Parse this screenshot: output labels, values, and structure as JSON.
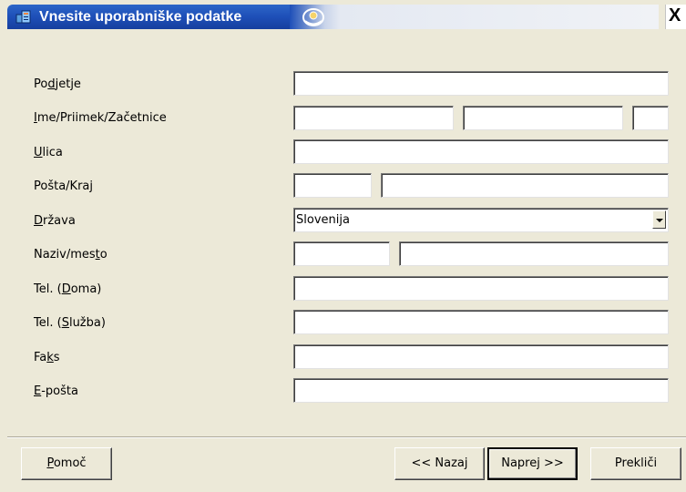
{
  "window": {
    "title": "Vnesite uporabniške podatke",
    "close_glyph": "X"
  },
  "form": {
    "company_label": "Podjetje",
    "company_value": "",
    "name_label": "Ime/Priimek/Začetnice",
    "first_name_value": "",
    "last_name_value": "",
    "initials_value": "",
    "street_label": "Ulica",
    "street_value": "",
    "post_label": "Pošta/Kraj",
    "postcode_value": "",
    "city_value": "",
    "country_label": "Država",
    "country_value": "Slovenija",
    "title_label": "Naziv/mesto",
    "title_value": "",
    "position_value": "",
    "phone_home_label": "Tel. (Doma)",
    "phone_home_value": "",
    "phone_work_label": "Tel. (Služba)",
    "phone_work_value": "",
    "fax_label": "Faks",
    "fax_value": "",
    "email_label": "E-pošta",
    "email_value": ""
  },
  "buttons": {
    "help": "Pomoč",
    "back": "<< Nazaj",
    "next": "Naprej >>",
    "cancel": "Prekliči"
  },
  "colors": {
    "titlebar_blue": "#1e4fb8",
    "dialog_bg": "#ece9d8"
  },
  "icons": [
    "setup-app-icon",
    "swirl-logo-icon",
    "close-icon",
    "dropdown-arrow-icon"
  ]
}
